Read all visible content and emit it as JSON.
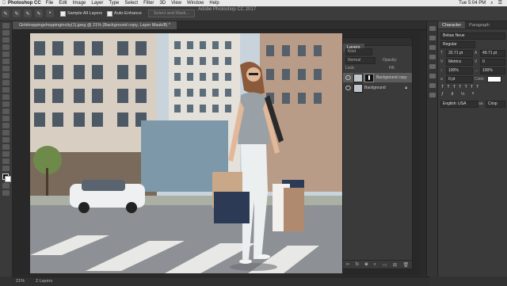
{
  "menubar": {
    "apple": "",
    "app": "Photoshop CC",
    "items": [
      "File",
      "Edit",
      "Image",
      "Layer",
      "Type",
      "Select",
      "Filter",
      "3D",
      "View",
      "Window",
      "Help"
    ],
    "clock": "Tue 5:04 PM"
  },
  "window_title": "Adobe Photoshop CC 2017",
  "options": {
    "sample_all_layers": "Sample All Layers",
    "auto_enhance": "Auto-Enhance",
    "select_subject": "Select and Mask..."
  },
  "document": {
    "tab_title": "Girlshoppingshoppingincity(1).jpeg @ 21% (Background copy, Layer Mask/8) *"
  },
  "status": {
    "zoom": "21%",
    "layers": "2 Layers"
  },
  "layers_panel": {
    "tab": "Layers",
    "kind": "Kind",
    "mode": "Normal",
    "opacity": "Opacity:",
    "lock": "Lock:",
    "fill": "Fill:",
    "layers": [
      {
        "name": "Background copy"
      },
      {
        "name": "Background"
      }
    ],
    "footer_icons": [
      "link-icon",
      "fx-icon",
      "mask-icon",
      "adjustment-icon",
      "folder-icon",
      "new-layer-icon",
      "trash-icon"
    ]
  },
  "character_panel": {
    "tabs": [
      "Character",
      "Paragraph"
    ],
    "font_family": "Bebas Neue",
    "font_style": "Regular",
    "size": "32.71 pt",
    "leading": "49.71 pt",
    "kerning": "Metrics",
    "tracking": "0",
    "vscale": "100%",
    "hscale": "100%",
    "baseline": "0 pt",
    "color_label": "Color:",
    "color": "#ffffff",
    "language": "English: USA",
    "antialias": "Crisp"
  }
}
